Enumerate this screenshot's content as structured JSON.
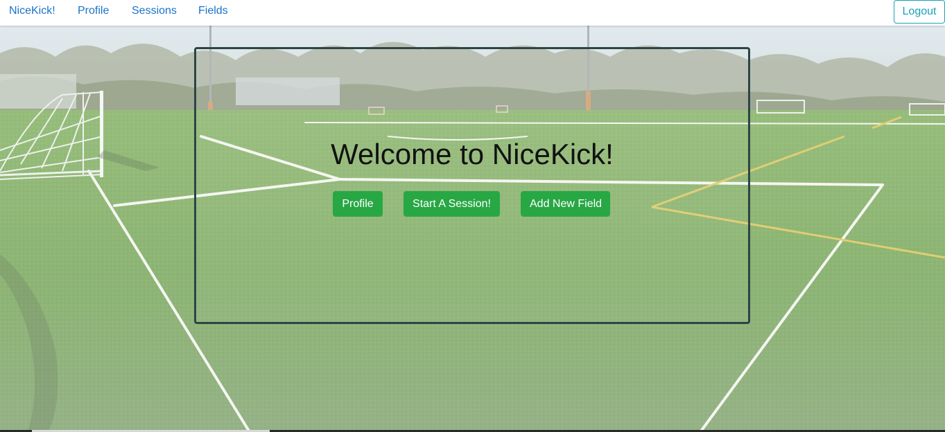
{
  "navbar": {
    "brand": "NiceKick!",
    "links": [
      "Profile",
      "Sessions",
      "Fields"
    ],
    "logout_label": "Logout",
    "link_color": "#1a73c9",
    "logout_color": "#17a2b8"
  },
  "hero": {
    "background": "soccer field photo with goals and tree line",
    "title": "Welcome to NiceKick!",
    "buttons": [
      "Profile",
      "Start A Session!",
      "Add New Field"
    ],
    "button_color": "#28a745",
    "card_border_color": "#2b4545"
  }
}
